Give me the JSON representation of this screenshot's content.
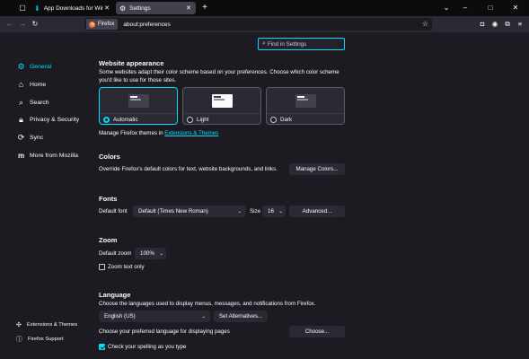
{
  "tabs": [
    {
      "title": "App Downloads for Windows",
      "icon": "download-icon",
      "active": false
    },
    {
      "title": "Settings",
      "icon": "gear-icon",
      "active": true
    }
  ],
  "window_controls": {
    "minimize": "–",
    "maximize": "□",
    "close": "✕"
  },
  "nav": {
    "identity_label": "Firefox",
    "url": "about:preferences"
  },
  "search": {
    "placeholder": "Find in Settings"
  },
  "sidebar": {
    "items": [
      {
        "label": "General",
        "icon": "gear-icon",
        "selected": true
      },
      {
        "label": "Home",
        "icon": "home-icon",
        "selected": false
      },
      {
        "label": "Search",
        "icon": "search-icon",
        "selected": false
      },
      {
        "label": "Privacy & Security",
        "icon": "lock-icon",
        "selected": false
      },
      {
        "label": "Sync",
        "icon": "sync-icon",
        "selected": false
      },
      {
        "label": "More from Mozilla",
        "icon": "mozilla-icon",
        "selected": false
      }
    ],
    "footer": [
      {
        "label": "Extensions & Themes",
        "icon": "puzzle-icon"
      },
      {
        "label": "Firefox Support",
        "icon": "help-icon"
      }
    ]
  },
  "website_appearance": {
    "heading": "Website appearance",
    "description": "Some websites adapt their color scheme based on your preferences. Choose which color scheme you'd like to use for those sites.",
    "options": [
      {
        "label": "Automatic",
        "selected": true
      },
      {
        "label": "Light",
        "selected": false
      },
      {
        "label": "Dark",
        "selected": false
      }
    ],
    "manage_prefix": "Manage Firefox themes in",
    "manage_link": "Extensions & Themes"
  },
  "colors": {
    "heading": "Colors",
    "description": "Override Firefox's default colors for text, website backgrounds, and links.",
    "button": "Manage Colors..."
  },
  "fonts": {
    "heading": "Fonts",
    "default_font_label": "Default font",
    "default_font_value": "Default (Times New Roman)",
    "size_label": "Size",
    "size_value": "16",
    "advanced_button": "Advanced..."
  },
  "zoom": {
    "heading": "Zoom",
    "default_zoom_label": "Default zoom",
    "default_zoom_value": "100%",
    "zoom_text_only_label": "Zoom text only",
    "zoom_text_only_checked": false
  },
  "language": {
    "heading": "Language",
    "description": "Choose the languages used to display menus, messages, and notifications from Firefox.",
    "language_value": "English (US)",
    "set_alternatives_button": "Set Alternatives...",
    "pages_label": "Choose your preferred language for displaying pages",
    "choose_button": "Choose...",
    "spell_check_label": "Check your spelling as you type",
    "spell_check_checked": true
  },
  "colors_accent": {
    "accent": "#00ddff",
    "background": "#1c1b22",
    "surface": "#2b2a33"
  }
}
